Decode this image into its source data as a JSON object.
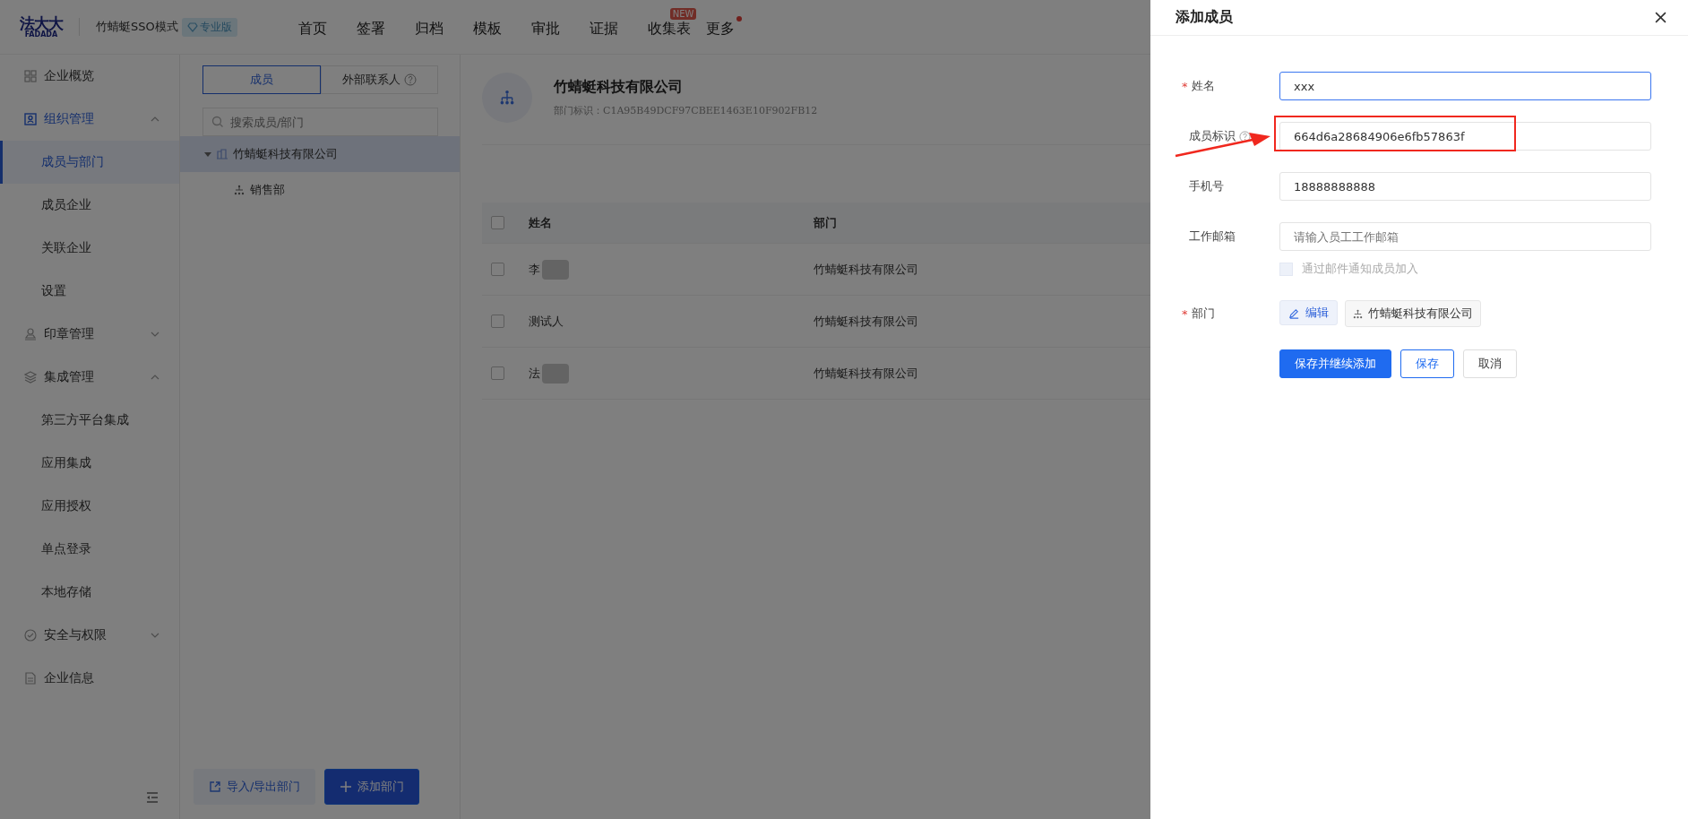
{
  "top_bar": {
    "logo": {
      "name": "法大大",
      "subtitle": "FADADA"
    },
    "mode": "竹蜻蜓SSO模式",
    "edition_badge": "专业版",
    "nav": [
      {
        "label": "首页",
        "dot": false
      },
      {
        "label": "签署",
        "dot": false
      },
      {
        "label": "归档",
        "dot": false
      },
      {
        "label": "模板",
        "dot": false
      },
      {
        "label": "审批",
        "dot": false
      },
      {
        "label": "证据",
        "dot": false
      },
      {
        "label": "收集表",
        "badge": "NEW",
        "dot": false
      },
      {
        "label": "更多",
        "dot": true
      }
    ]
  },
  "sidebar": {
    "items": [
      {
        "label": "企业概览",
        "selected": false
      },
      {
        "label": "组织管理",
        "expanded": true,
        "selected": true,
        "children": [
          {
            "label": "成员与部门",
            "selected": true
          },
          {
            "label": "成员企业",
            "selected": false
          },
          {
            "label": "关联企业",
            "selected": false
          },
          {
            "label": "设置",
            "selected": false
          }
        ]
      },
      {
        "label": "印章管理",
        "expanded": false,
        "selected": false
      },
      {
        "label": "集成管理",
        "expanded": true,
        "selected": false,
        "children": [
          {
            "label": "第三方平台集成",
            "selected": false
          },
          {
            "label": "应用集成",
            "selected": false
          },
          {
            "label": "应用授权",
            "selected": false
          },
          {
            "label": "单点登录",
            "selected": false
          },
          {
            "label": "本地存储",
            "selected": false
          }
        ]
      },
      {
        "label": "安全与权限",
        "expanded": false,
        "selected": false
      },
      {
        "label": "企业信息",
        "selected": false
      }
    ]
  },
  "tree_panel": {
    "tabs": [
      {
        "label": "成员",
        "selected": true,
        "help": false
      },
      {
        "label": "外部联系人",
        "selected": false,
        "help": true
      }
    ],
    "search": {
      "placeholder": "搜索成员/部门"
    },
    "tree": [
      {
        "label": "竹蜻蜓科技有限公司",
        "expanded": true,
        "selected": true,
        "children": [
          {
            "label": "销售部",
            "selected": false
          }
        ]
      }
    ],
    "buttons": [
      {
        "label": "导入/导出部门",
        "kind": "secondary"
      },
      {
        "label": "添加部门",
        "kind": "primary"
      }
    ]
  },
  "department": {
    "name": "竹蜻蜓科技有限公司",
    "id_line": "部门标识：C1A95B49DCF97CBEE1463E10F902FB12"
  },
  "table": {
    "columns": [
      "姓名",
      "部门"
    ],
    "header_checked": false,
    "rows": [
      {
        "checked": false,
        "name": "李",
        "blurred": true,
        "department": "竹蜻蜓科技有限公司"
      },
      {
        "checked": false,
        "name": "测试人",
        "blurred": false,
        "department": "竹蜻蜓科技有限公司"
      },
      {
        "checked": false,
        "name": "法",
        "blurred": true,
        "department": "竹蜻蜓科技有限公司"
      }
    ]
  },
  "drawer": {
    "title": "添加成员",
    "required_mark": "*",
    "fields": [
      {
        "label": "姓名",
        "required": true,
        "help": false,
        "value": "xxx",
        "focused": true,
        "highlighted": false
      },
      {
        "label": "成员标识",
        "required": false,
        "help": true,
        "value": "664d6a28684906e6fb57863f",
        "focused": false,
        "highlighted": true
      },
      {
        "label": "手机号",
        "required": false,
        "help": false,
        "value": "18888888888",
        "focused": false,
        "highlighted": false
      },
      {
        "label": "工作邮箱",
        "required": false,
        "help": false,
        "placeholder": "请输入员工工作邮箱",
        "focused": false,
        "highlighted": false
      }
    ],
    "email_notify": {
      "label": "通过邮件通知成员加入",
      "checked": false
    },
    "department": {
      "label": "部门",
      "required": true,
      "edit_button": "编辑",
      "tags": [
        "竹蜻蜓科技有限公司"
      ]
    },
    "buttons": [
      {
        "label": "保存并继续添加",
        "kind": "primary"
      },
      {
        "label": "保存",
        "kind": "outline"
      },
      {
        "label": "取消",
        "kind": "default"
      }
    ]
  }
}
